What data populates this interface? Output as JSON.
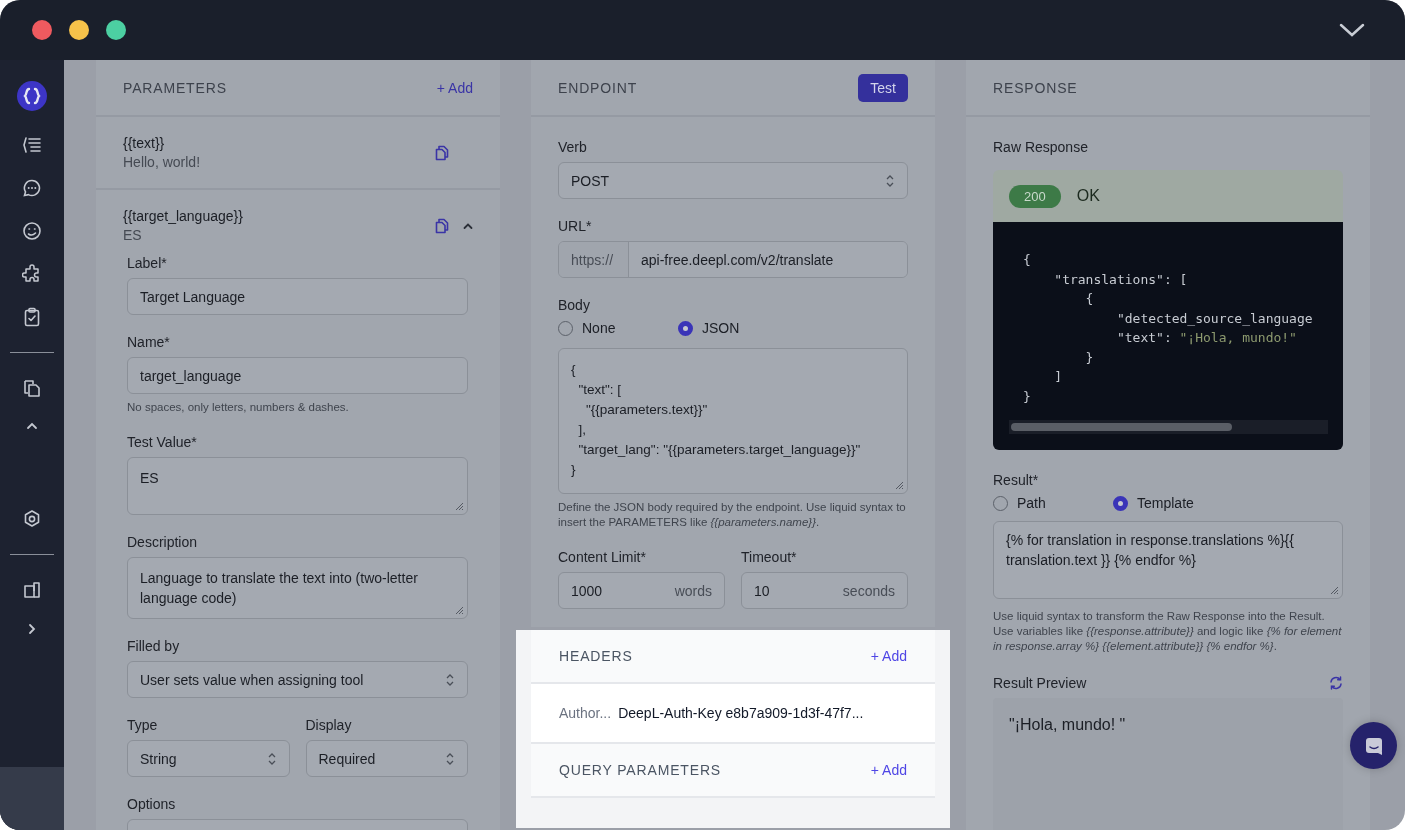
{
  "parameters": {
    "title": "PARAMETERS",
    "add": "+ Add",
    "items": [
      {
        "name": "{{text}}",
        "value": "Hello, world!",
        "expanded": false
      },
      {
        "name": "{{target_language}}",
        "value": "ES",
        "expanded": true,
        "fields": [
          {
            "kind": "input",
            "label": "Label*",
            "value": "Target Language"
          },
          {
            "kind": "input",
            "label": "Name*",
            "value": "target_language",
            "hint": "No spaces, only letters, numbers & dashes."
          },
          {
            "kind": "textarea",
            "label": "Test Value*",
            "value": "ES"
          },
          {
            "kind": "textarea",
            "label": "Description",
            "value": "Language to translate the text into (two-letter language code)"
          },
          {
            "kind": "select",
            "label": "Filled by",
            "value": "User sets value when assigning tool"
          },
          {
            "kind": "pair",
            "fields": [
              {
                "label": "Type",
                "value": "String"
              },
              {
                "label": "Display",
                "value": "Required"
              }
            ]
          },
          {
            "kind": "input",
            "label": "Options"
          }
        ]
      }
    ]
  },
  "endpoint": {
    "title": "ENDPOINT",
    "test_button": "Test",
    "verb": {
      "label": "Verb",
      "value": "POST"
    },
    "url": {
      "label": "URL*",
      "prefix": "https://",
      "value": "api-free.deepl.com/v2/translate"
    },
    "body": {
      "label": "Body",
      "options": [
        {
          "label": "None",
          "selected": false
        },
        {
          "label": "JSON",
          "selected": true
        }
      ],
      "code": "{\n  \"text\": [\n    \"{{parameters.text}}\"\n  ],\n  \"target_lang\": \"{{parameters.target_language}}\"\n}",
      "hint": "Define the JSON body required by the endpoint. Use liquid syntax to insert the PARAMETERS like *{{parameters.name}}*."
    },
    "limits": [
      {
        "label": "Content Limit*",
        "value": "1000",
        "unit": "words"
      },
      {
        "label": "Timeout*",
        "value": "10",
        "unit": "seconds"
      }
    ]
  },
  "headers": {
    "title": "HEADERS",
    "add": "+ Add",
    "rows": [
      {
        "key": "Author...",
        "value": "DeepL-Auth-Key e8b7a909-1d3f-47f7..."
      }
    ]
  },
  "query_parameters": {
    "title": "QUERY PARAMETERS",
    "add": "+ Add"
  },
  "response": {
    "title": "RESPONSE",
    "raw_label": "Raw Response",
    "status_code": "200",
    "status_text": "OK",
    "code_lines": [
      {
        "text": "{"
      },
      {
        "text": "    \"translations\": ["
      },
      {
        "text": "        {"
      },
      {
        "text": "            \"detected_source_language"
      },
      {
        "text": "            \"text\": ",
        "string": "\"¡Hola, mundo!\""
      },
      {
        "text": "        }"
      },
      {
        "text": "    ]"
      },
      {
        "text": "}"
      }
    ],
    "result": {
      "label": "Result*",
      "options": [
        {
          "label": "Path",
          "selected": false
        },
        {
          "label": "Template",
          "selected": true
        }
      ],
      "value": "{% for translation in response.translations %}{{ translation.text }} {% endfor %}",
      "hint": "Use liquid syntax to transform the Raw Response into the Result. Use variables like *{{response.attribute}}* and logic like *{% for element in response.array %} {{element.attribute}} {% endfor %}*."
    },
    "preview": {
      "label": "Result Preview",
      "value": "\"¡Hola, mundo! \""
    }
  }
}
